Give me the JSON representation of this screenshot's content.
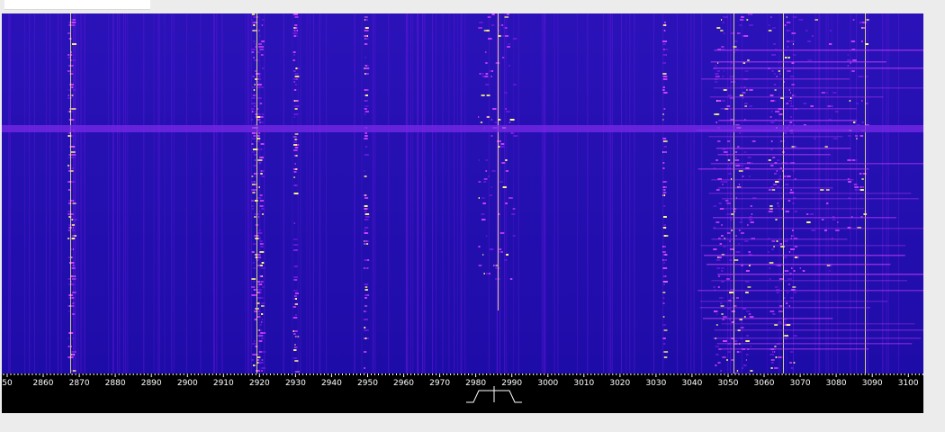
{
  "app": {
    "top_field_value": ""
  },
  "waterfall": {
    "background": "#1a0aa0",
    "hot_color": "#ffff80",
    "mid_color": "#d040ff",
    "low_color": "#6a18e0"
  },
  "scale": {
    "unit_step": 10,
    "labels": [
      "50",
      "2860",
      "2870",
      "2880",
      "2890",
      "2900",
      "2910",
      "2920",
      "2930",
      "2940",
      "2950",
      "2960",
      "2970",
      "2980",
      "2990",
      "3000",
      "3010",
      "3020",
      "3030",
      "3040",
      "3050",
      "3060",
      "3070",
      "3080",
      "3090",
      "3100"
    ],
    "tick_color": "#ffffff",
    "passband_color": "#ffffff",
    "passband_center": 2987
  }
}
